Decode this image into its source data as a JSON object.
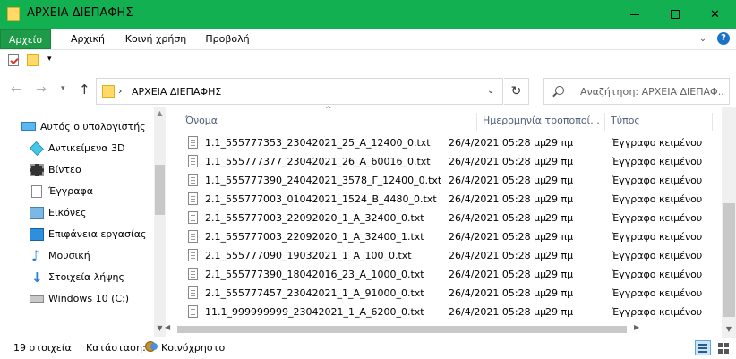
{
  "window": {
    "title": "ΑΡΧΕΙΑ ΔΙΕΠΑΦΗΣ"
  },
  "ribbon": {
    "tabs": [
      {
        "label": "Αρχείο"
      },
      {
        "label": "Αρχική"
      },
      {
        "label": "Κοινή χρήση"
      },
      {
        "label": "Προβολή"
      }
    ],
    "help": "?"
  },
  "address": {
    "path": "ΑΡΧΕΙΑ ΔΙΕΠΑΦΗΣ"
  },
  "search": {
    "placeholder": "Αναζήτηση: ΑΡΧΕΙΑ ΔΙΕΠΑΦ..."
  },
  "sidebar": {
    "items": [
      {
        "label": "Αυτός ο υπολογιστής"
      },
      {
        "label": "Αντικείμενα 3D"
      },
      {
        "label": "Βίντεο"
      },
      {
        "label": "Έγγραφα"
      },
      {
        "label": "Εικόνες"
      },
      {
        "label": "Επιφάνεια εργασίας"
      },
      {
        "label": "Μουσική"
      },
      {
        "label": "Στοιχεία λήψης"
      },
      {
        "label": "Windows 10 (C:)"
      }
    ]
  },
  "filelist": {
    "columns": {
      "name": "Όνομα",
      "date": "Ημερομηνία τροποποί...",
      "type": "Τύπος"
    },
    "rows": [
      {
        "name": "1.1_555777353_23042021_25_A_12400_0.txt",
        "date": "26/4/2021 05:28 μμ",
        "size": "29 πμ",
        "type": "Έγγραφο κειμένου"
      },
      {
        "name": "1.1_555777377_23042021_26_A_60016_0.txt",
        "date": "26/4/2021 05:28 μμ",
        "size": "29 πμ",
        "type": "Έγγραφο κειμένου"
      },
      {
        "name": "1.1_555777390_24042021_3578_Γ_12400_0.txt",
        "date": "26/4/2021 05:28 μμ",
        "size": "29 πμ",
        "type": "Έγγραφο κειμένου"
      },
      {
        "name": "2.1_555777003_01042021_1524_B_4480_0.txt",
        "date": "26/4/2021 05:28 μμ",
        "size": "29 πμ",
        "type": "Έγγραφο κειμένου"
      },
      {
        "name": "2.1_555777003_22092020_1_A_32400_0.txt",
        "date": "26/4/2021 05:28 μμ",
        "size": "29 πμ",
        "type": "Έγγραφο κειμένου"
      },
      {
        "name": "2.1_555777003_22092020_1_A_32400_1.txt",
        "date": "26/4/2021 05:28 μμ",
        "size": "29 πμ",
        "type": "Έγγραφο κειμένου"
      },
      {
        "name": "2.1_555777090_19032021_1_A_100_0.txt",
        "date": "26/4/2021 05:28 μμ",
        "size": "29 πμ",
        "type": "Έγγραφο κειμένου"
      },
      {
        "name": "2.1_555777390_18042016_23_A_1000_0.txt",
        "date": "26/4/2021 05:28 μμ",
        "size": "29 πμ",
        "type": "Έγγραφο κειμένου"
      },
      {
        "name": "2.1_555777457_23042021_1_A_91000_0.txt",
        "date": "26/4/2021 05:28 μμ",
        "size": "29 πμ",
        "type": "Έγγραφο κειμένου"
      },
      {
        "name": "11.1_999999999_23042021_1_A_6200_0.txt",
        "date": "26/4/2021 05:28 μμ",
        "size": "29 πμ",
        "type": "Έγγραφο κειμένου"
      }
    ]
  },
  "status": {
    "count": "19 στοιχεία",
    "state_label": "Κατάσταση:",
    "state_value": "Κοινόχρηστο"
  },
  "colors": {
    "titlebar": "#12b050",
    "file_tab": "#1e9b48"
  }
}
